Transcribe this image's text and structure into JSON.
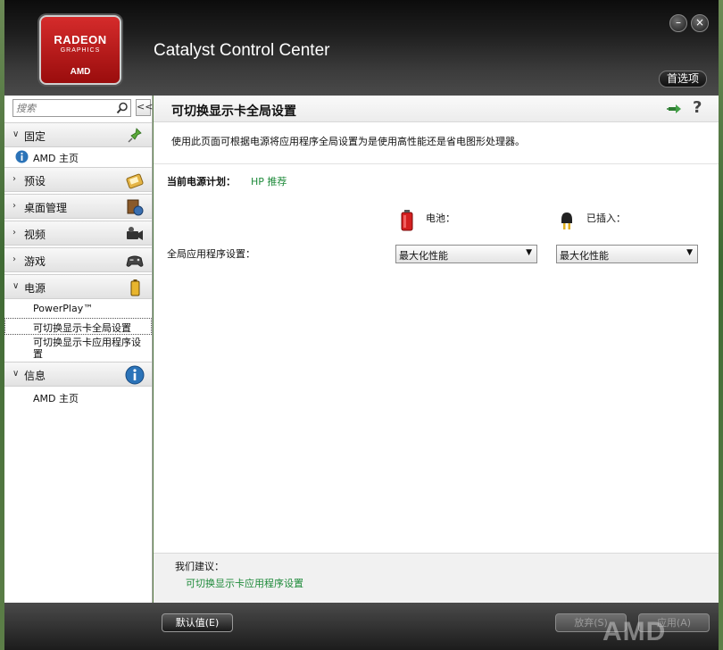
{
  "header": {
    "logo": {
      "line1": "RADEON",
      "line2": "GRAPHICS",
      "line3": "AMD"
    },
    "app_title": "Catalyst Control Center",
    "minimize_label": "–",
    "close_label": "×",
    "preferences_label": "首选项"
  },
  "sidebar": {
    "search_placeholder": "搜索",
    "collapse_label": "<<",
    "categories": [
      {
        "label": "固定",
        "expanded": true,
        "icon": "pin-icon"
      },
      {
        "label": "预设",
        "expanded": false,
        "icon": "preset-icon"
      },
      {
        "label": "桌面管理",
        "expanded": false,
        "icon": "desktop-management-icon"
      },
      {
        "label": "视频",
        "expanded": false,
        "icon": "video-icon"
      },
      {
        "label": "游戏",
        "expanded": false,
        "icon": "gamepad-icon"
      },
      {
        "label": "电源",
        "expanded": true,
        "icon": "battery-icon"
      },
      {
        "label": "信息",
        "expanded": true,
        "icon": "info-icon"
      }
    ],
    "pinned_items": [
      "AMD 主页"
    ],
    "power_items": [
      "PowerPlay™",
      "可切换显示卡全局设置",
      "可切换显示卡应用程序设置"
    ],
    "info_items": [
      "AMD 主页"
    ]
  },
  "main": {
    "page_title": "可切换显示卡全局设置",
    "description": "使用此页面可根据电源将应用程序全局设置为是使用高性能还是省电图形处理器。",
    "power_plan_label": "当前电源计划：",
    "power_plan_value": "HP 推荐",
    "battery_label": "电池：",
    "plugged_label": "已插入：",
    "global_setting_label": "全局应用程序设置：",
    "battery_dropdown_value": "最大化性能",
    "plugged_dropdown_value": "最大化性能",
    "suggest_label": "我们建议：",
    "suggest_link": "可切换显示卡应用程序设置"
  },
  "footer": {
    "default_button": "默认值(E)",
    "discard_button": "放弃(S)",
    "apply_button": "应用(A)",
    "watermark": "AMD"
  },
  "colors": {
    "link_green": "#1e8a3a",
    "logo_red": "#c41e1e"
  }
}
